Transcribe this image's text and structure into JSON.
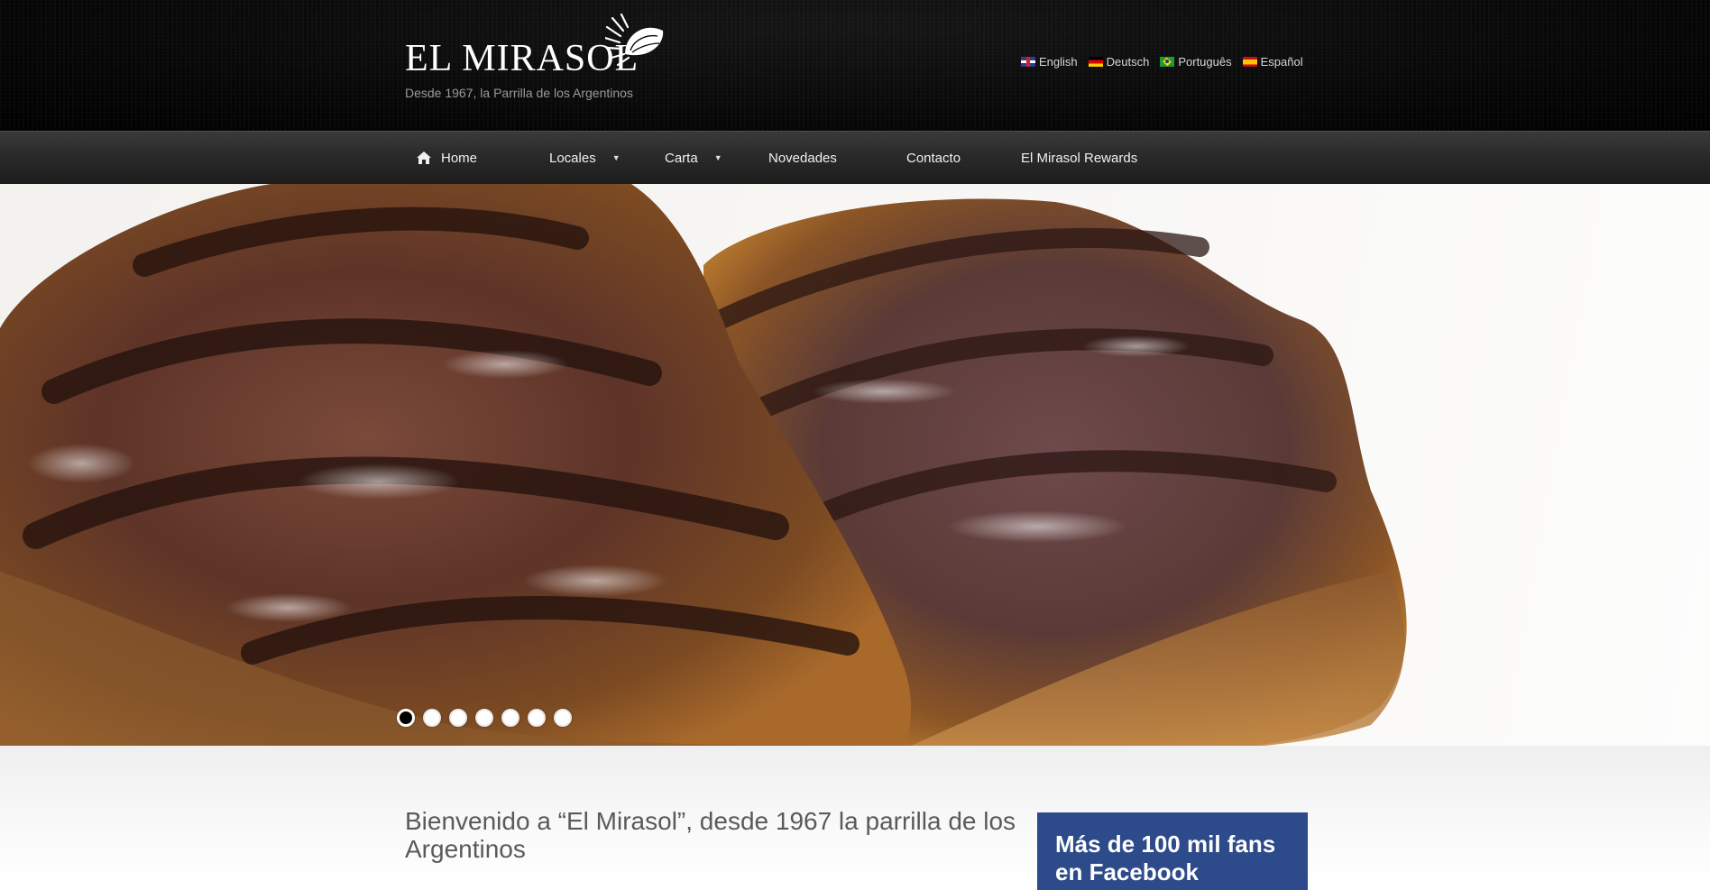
{
  "header": {
    "brand": "EL MIRASOL",
    "tagline": "Desde 1967, la Parrilla de los Argentinos",
    "languages": [
      {
        "label": "English",
        "icon": "uk-flag-icon"
      },
      {
        "label": "Deutsch",
        "icon": "germany-flag-icon"
      },
      {
        "label": "Português",
        "icon": "brazil-flag-icon"
      },
      {
        "label": "Español",
        "icon": "spain-flag-icon"
      }
    ]
  },
  "nav": {
    "items": [
      {
        "label": "Home",
        "icon": "home-icon",
        "has_dropdown": false
      },
      {
        "label": "Locales",
        "has_dropdown": true
      },
      {
        "label": "Carta",
        "has_dropdown": true
      },
      {
        "label": "Novedades",
        "has_dropdown": false
      },
      {
        "label": "Contacto",
        "has_dropdown": false
      },
      {
        "label": "El Mirasol Rewards",
        "has_dropdown": false
      }
    ]
  },
  "slider": {
    "total_slides": 7,
    "active_slide": 1,
    "image": "grilled-steaks-photo"
  },
  "main": {
    "welcome_title": "Bienvenido a “El Mirasol”, desde 1967 la parrilla de los Argentinos"
  },
  "sidebar": {
    "facebook_title": "Más de 100 mil fans en Facebook",
    "facebook_color": "#2d4a8a"
  }
}
